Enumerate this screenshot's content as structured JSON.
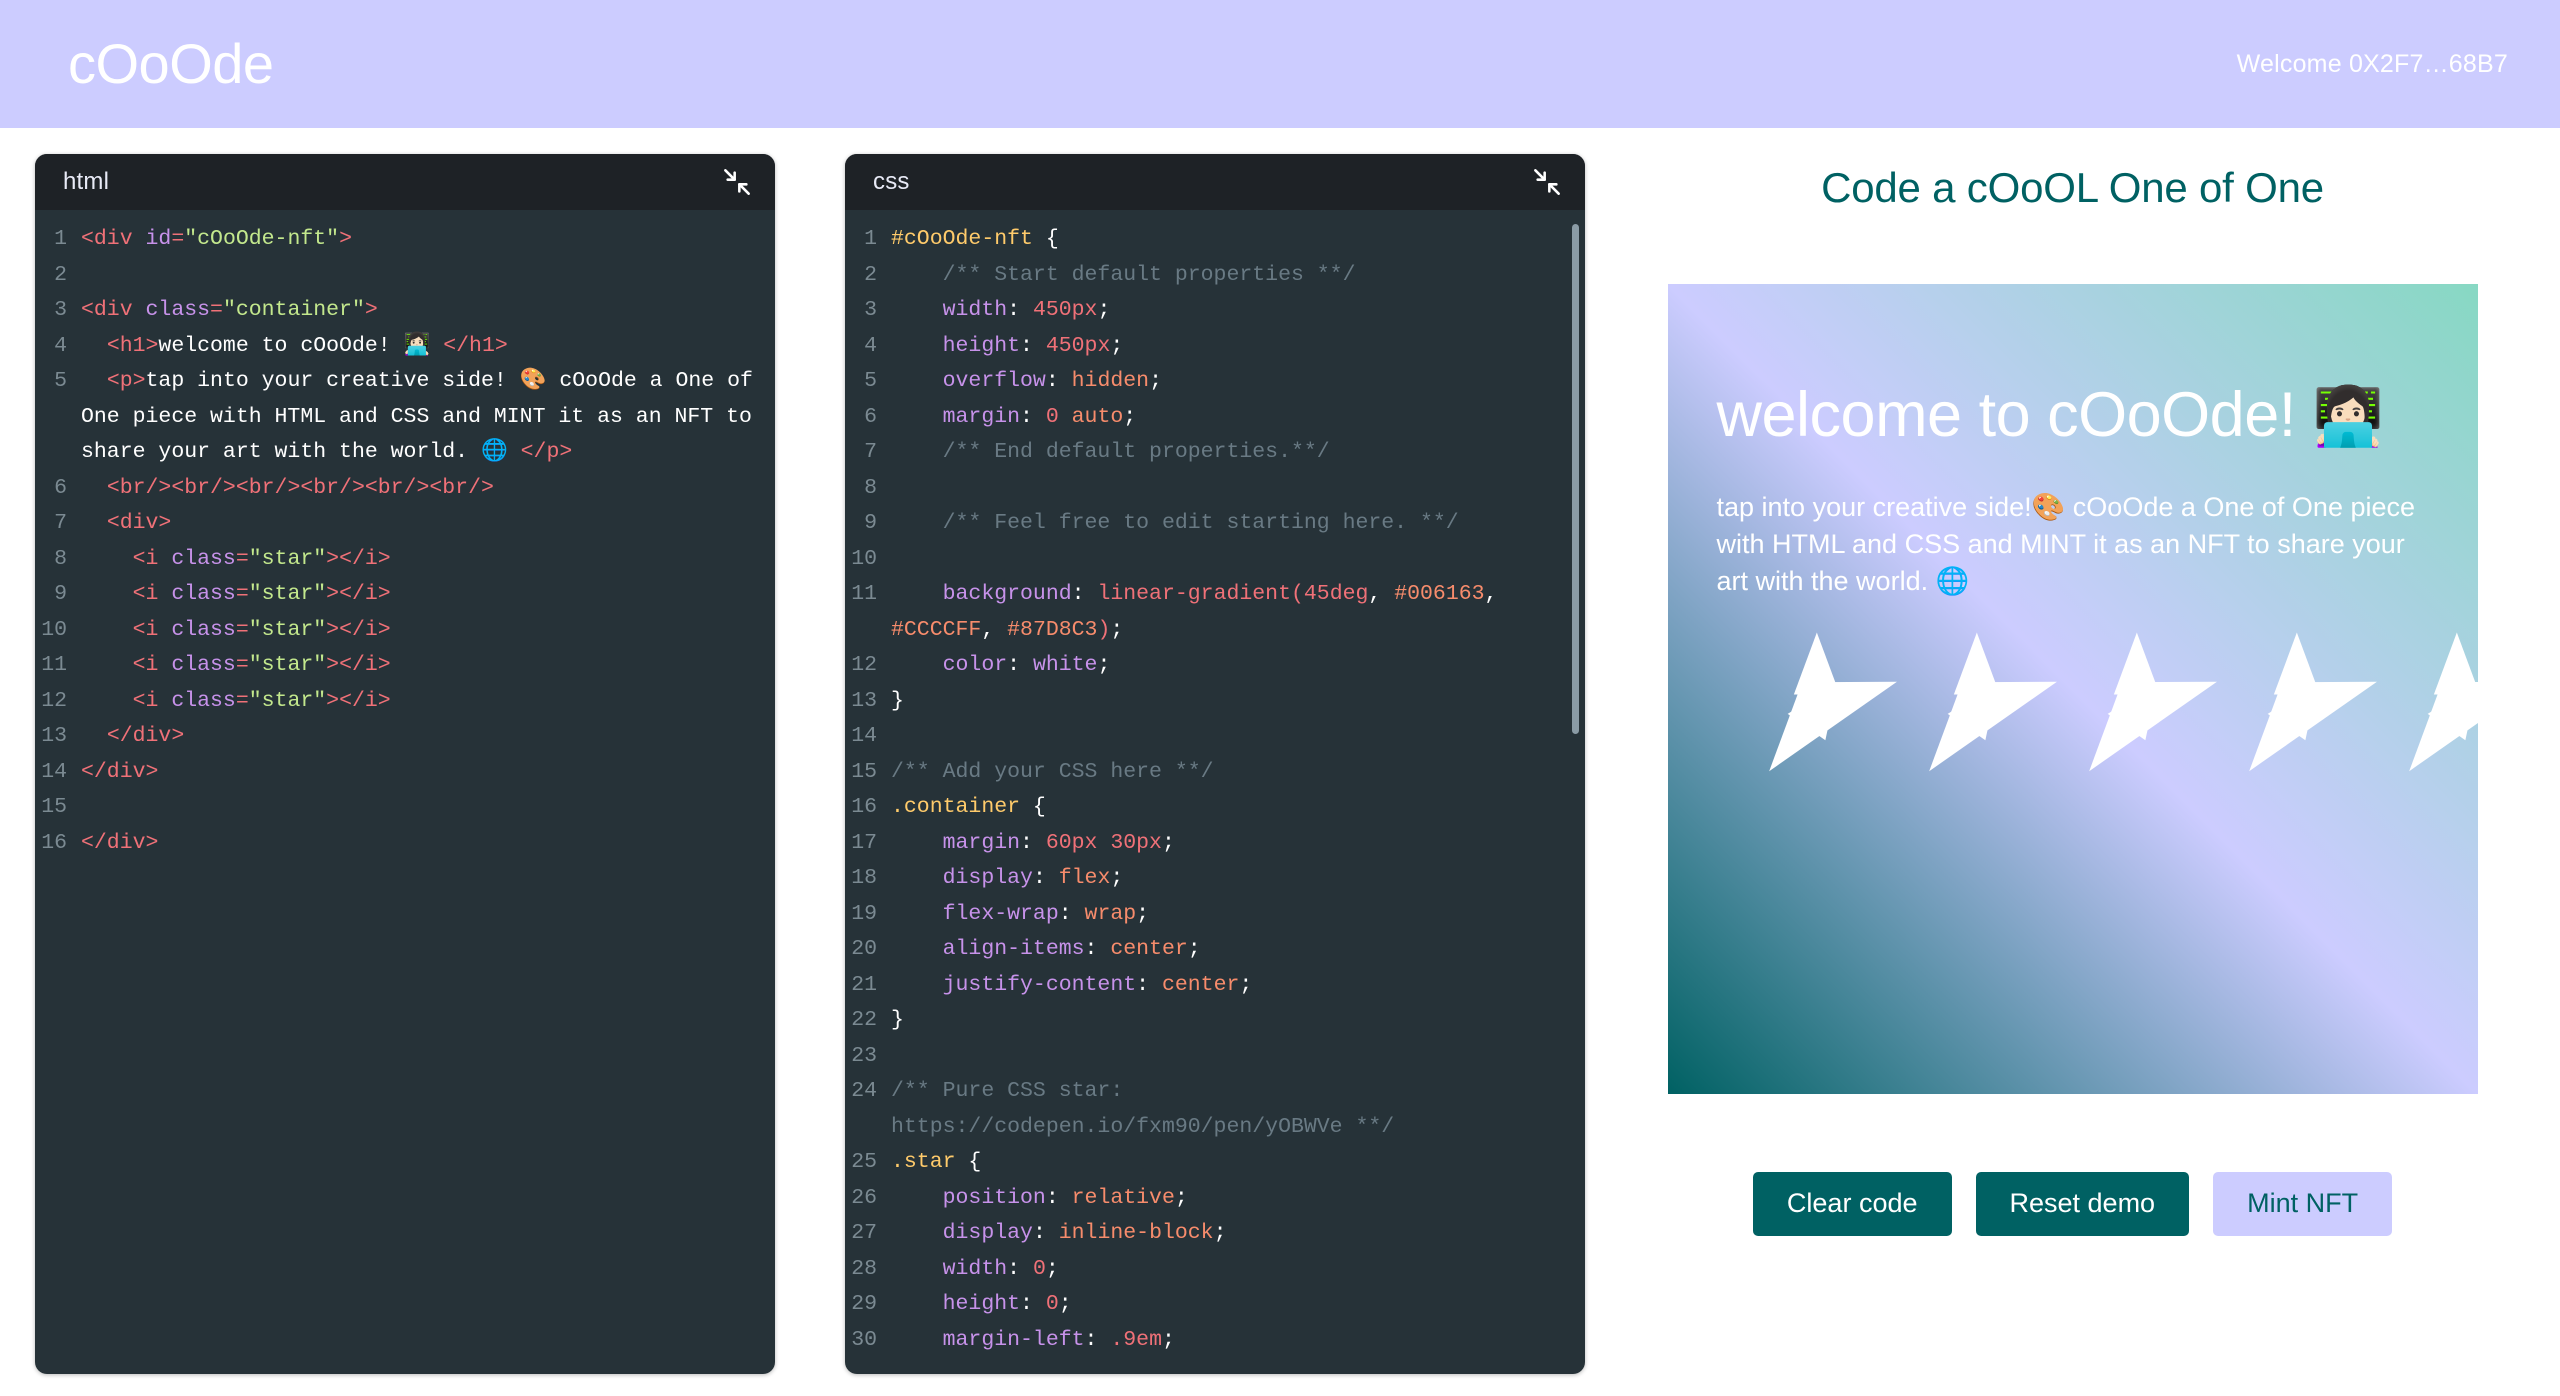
{
  "header": {
    "brand": "cOoOde",
    "wallet_welcome": "Welcome 0X2F7…68B7",
    "background_color": "#CCCCFF",
    "text_color": "#FFFFFF"
  },
  "editors": [
    {
      "title": "html",
      "collapse_icon": "collapse-arrows-icon",
      "lines": [
        {
          "n": "1",
          "tokens": [
            {
              "c": "t-tag",
              "t": "<div "
            },
            {
              "c": "t-attr",
              "t": "id"
            },
            {
              "c": "t-tag",
              "t": "="
            },
            {
              "c": "t-str",
              "t": "\"cOoOde-nft\""
            },
            {
              "c": "t-tag",
              "t": ">"
            }
          ]
        },
        {
          "n": "2",
          "tokens": []
        },
        {
          "n": "3",
          "tokens": [
            {
              "c": "t-tag",
              "t": "<div "
            },
            {
              "c": "t-attr",
              "t": "class"
            },
            {
              "c": "t-tag",
              "t": "="
            },
            {
              "c": "t-str",
              "t": "\"container\""
            },
            {
              "c": "t-tag",
              "t": ">"
            }
          ]
        },
        {
          "n": "4",
          "tokens": [
            {
              "c": "t-txt",
              "t": "  "
            },
            {
              "c": "t-tag",
              "t": "<h1>"
            },
            {
              "c": "t-txt",
              "t": "welcome to cOoOde! 👩🏻‍💻 "
            },
            {
              "c": "t-tag",
              "t": "</h1>"
            }
          ]
        },
        {
          "n": "5",
          "tokens": [
            {
              "c": "t-txt",
              "t": "  "
            },
            {
              "c": "t-tag",
              "t": "<p>"
            },
            {
              "c": "t-txt",
              "t": "tap into your creative side! 🎨 cOoOde a One of One piece with HTML and CSS and MINT it as an NFT to share your art with the world. 🌐 "
            },
            {
              "c": "t-tag",
              "t": "</p>"
            }
          ]
        },
        {
          "n": "6",
          "tokens": [
            {
              "c": "t-txt",
              "t": "  "
            },
            {
              "c": "t-tag",
              "t": "<br/><br/><br/><br/><br/><br/>"
            }
          ]
        },
        {
          "n": "7",
          "tokens": [
            {
              "c": "t-txt",
              "t": "  "
            },
            {
              "c": "t-tag",
              "t": "<div>"
            }
          ]
        },
        {
          "n": "8",
          "tokens": [
            {
              "c": "t-txt",
              "t": "    "
            },
            {
              "c": "t-tag",
              "t": "<i "
            },
            {
              "c": "t-attr",
              "t": "class"
            },
            {
              "c": "t-tag",
              "t": "="
            },
            {
              "c": "t-str",
              "t": "\"star\""
            },
            {
              "c": "t-tag",
              "t": "></i>"
            }
          ]
        },
        {
          "n": "9",
          "tokens": [
            {
              "c": "t-txt",
              "t": "    "
            },
            {
              "c": "t-tag",
              "t": "<i "
            },
            {
              "c": "t-attr",
              "t": "class"
            },
            {
              "c": "t-tag",
              "t": "="
            },
            {
              "c": "t-str",
              "t": "\"star\""
            },
            {
              "c": "t-tag",
              "t": "></i>"
            }
          ]
        },
        {
          "n": "10",
          "tokens": [
            {
              "c": "t-txt",
              "t": "    "
            },
            {
              "c": "t-tag",
              "t": "<i "
            },
            {
              "c": "t-attr",
              "t": "class"
            },
            {
              "c": "t-tag",
              "t": "="
            },
            {
              "c": "t-str",
              "t": "\"star\""
            },
            {
              "c": "t-tag",
              "t": "></i>"
            }
          ]
        },
        {
          "n": "11",
          "tokens": [
            {
              "c": "t-txt",
              "t": "    "
            },
            {
              "c": "t-tag",
              "t": "<i "
            },
            {
              "c": "t-attr",
              "t": "class"
            },
            {
              "c": "t-tag",
              "t": "="
            },
            {
              "c": "t-str",
              "t": "\"star\""
            },
            {
              "c": "t-tag",
              "t": "></i>"
            }
          ]
        },
        {
          "n": "12",
          "tokens": [
            {
              "c": "t-txt",
              "t": "    "
            },
            {
              "c": "t-tag",
              "t": "<i "
            },
            {
              "c": "t-attr",
              "t": "class"
            },
            {
              "c": "t-tag",
              "t": "="
            },
            {
              "c": "t-str",
              "t": "\"star\""
            },
            {
              "c": "t-tag",
              "t": "></i>"
            }
          ]
        },
        {
          "n": "13",
          "tokens": [
            {
              "c": "t-txt",
              "t": "  "
            },
            {
              "c": "t-tag",
              "t": "</div>"
            }
          ]
        },
        {
          "n": "14",
          "tokens": [
            {
              "c": "t-tag",
              "t": "</div>"
            }
          ]
        },
        {
          "n": "15",
          "tokens": []
        },
        {
          "n": "16",
          "tokens": [
            {
              "c": "t-tag",
              "t": "</div>"
            }
          ]
        }
      ]
    },
    {
      "title": "css",
      "collapse_icon": "collapse-arrows-icon",
      "lines": [
        {
          "n": "1",
          "tokens": [
            {
              "c": "t-sel",
              "t": "#cOoOde-nft"
            },
            {
              "c": "t-punc",
              "t": " {"
            }
          ]
        },
        {
          "n": "2",
          "tokens": [
            {
              "c": "t-comment",
              "t": "    /** Start default properties **/"
            }
          ]
        },
        {
          "n": "3",
          "tokens": [
            {
              "c": "t-prop",
              "t": "    width"
            },
            {
              "c": "t-punc",
              "t": ": "
            },
            {
              "c": "t-num",
              "t": "450px"
            },
            {
              "c": "t-punc",
              "t": ";"
            }
          ]
        },
        {
          "n": "4",
          "tokens": [
            {
              "c": "t-prop",
              "t": "    height"
            },
            {
              "c": "t-punc",
              "t": ": "
            },
            {
              "c": "t-num",
              "t": "450px"
            },
            {
              "c": "t-punc",
              "t": ";"
            }
          ]
        },
        {
          "n": "5",
          "tokens": [
            {
              "c": "t-prop",
              "t": "    overflow"
            },
            {
              "c": "t-punc",
              "t": ": "
            },
            {
              "c": "t-val",
              "t": "hidden"
            },
            {
              "c": "t-punc",
              "t": ";"
            }
          ]
        },
        {
          "n": "6",
          "tokens": [
            {
              "c": "t-prop",
              "t": "    margin"
            },
            {
              "c": "t-punc",
              "t": ": "
            },
            {
              "c": "t-num",
              "t": "0"
            },
            {
              "c": "t-punc",
              "t": " "
            },
            {
              "c": "t-val",
              "t": "auto"
            },
            {
              "c": "t-punc",
              "t": ";"
            }
          ]
        },
        {
          "n": "7",
          "tokens": [
            {
              "c": "t-comment",
              "t": "    /** End default properties.**/"
            }
          ]
        },
        {
          "n": "8",
          "tokens": []
        },
        {
          "n": "9",
          "tokens": [
            {
              "c": "t-comment",
              "t": "    /** Feel free to edit starting here. **/"
            }
          ]
        },
        {
          "n": "10",
          "tokens": []
        },
        {
          "n": "11",
          "tokens": [
            {
              "c": "t-prop",
              "t": "    background"
            },
            {
              "c": "t-punc",
              "t": ": "
            },
            {
              "c": "t-func",
              "t": "linear-gradient("
            },
            {
              "c": "t-num",
              "t": "45deg"
            },
            {
              "c": "t-punc",
              "t": ", "
            },
            {
              "c": "t-val",
              "t": "#006163"
            },
            {
              "c": "t-punc",
              "t": ", "
            },
            {
              "c": "t-val",
              "t": "#CCCCFF"
            },
            {
              "c": "t-punc",
              "t": ", "
            },
            {
              "c": "t-val",
              "t": "#87D8C3"
            },
            {
              "c": "t-func",
              "t": ")"
            },
            {
              "c": "t-punc",
              "t": ";"
            }
          ]
        },
        {
          "n": "12",
          "tokens": [
            {
              "c": "t-prop",
              "t": "    color"
            },
            {
              "c": "t-punc",
              "t": ": "
            },
            {
              "c": "t-prop",
              "t": "white"
            },
            {
              "c": "t-punc",
              "t": ";"
            }
          ]
        },
        {
          "n": "13",
          "tokens": [
            {
              "c": "t-punc",
              "t": "}"
            }
          ]
        },
        {
          "n": "14",
          "tokens": []
        },
        {
          "n": "15",
          "tokens": [
            {
              "c": "t-comment",
              "t": "/** Add your CSS here **/"
            }
          ]
        },
        {
          "n": "16",
          "tokens": [
            {
              "c": "t-sel",
              "t": ".container"
            },
            {
              "c": "t-punc",
              "t": " {"
            }
          ]
        },
        {
          "n": "17",
          "tokens": [
            {
              "c": "t-prop",
              "t": "    margin"
            },
            {
              "c": "t-punc",
              "t": ": "
            },
            {
              "c": "t-num",
              "t": "60px 30px"
            },
            {
              "c": "t-punc",
              "t": ";"
            }
          ]
        },
        {
          "n": "18",
          "tokens": [
            {
              "c": "t-prop",
              "t": "    display"
            },
            {
              "c": "t-punc",
              "t": ": "
            },
            {
              "c": "t-val",
              "t": "flex"
            },
            {
              "c": "t-punc",
              "t": ";"
            }
          ]
        },
        {
          "n": "19",
          "tokens": [
            {
              "c": "t-prop",
              "t": "    flex-wrap"
            },
            {
              "c": "t-punc",
              "t": ": "
            },
            {
              "c": "t-val",
              "t": "wrap"
            },
            {
              "c": "t-punc",
              "t": ";"
            }
          ]
        },
        {
          "n": "20",
          "tokens": [
            {
              "c": "t-prop",
              "t": "    align-items"
            },
            {
              "c": "t-punc",
              "t": ": "
            },
            {
              "c": "t-val",
              "t": "center"
            },
            {
              "c": "t-punc",
              "t": ";"
            }
          ]
        },
        {
          "n": "21",
          "tokens": [
            {
              "c": "t-prop",
              "t": "    justify-content"
            },
            {
              "c": "t-punc",
              "t": ": "
            },
            {
              "c": "t-val",
              "t": "center"
            },
            {
              "c": "t-punc",
              "t": ";"
            }
          ]
        },
        {
          "n": "22",
          "tokens": [
            {
              "c": "t-punc",
              "t": "}"
            }
          ]
        },
        {
          "n": "23",
          "tokens": []
        },
        {
          "n": "24",
          "tokens": [
            {
              "c": "t-comment",
              "t": "/** Pure CSS star: https://codepen.io/fxm90/pen/yOBWVe **/"
            }
          ]
        },
        {
          "n": "25",
          "tokens": [
            {
              "c": "t-sel",
              "t": ".star"
            },
            {
              "c": "t-punc",
              "t": " {"
            }
          ]
        },
        {
          "n": "26",
          "tokens": [
            {
              "c": "t-prop",
              "t": "    position"
            },
            {
              "c": "t-punc",
              "t": ": "
            },
            {
              "c": "t-val",
              "t": "relative"
            },
            {
              "c": "t-punc",
              "t": ";"
            }
          ]
        },
        {
          "n": "27",
          "tokens": [
            {
              "c": "t-prop",
              "t": "    display"
            },
            {
              "c": "t-punc",
              "t": ": "
            },
            {
              "c": "t-val",
              "t": "inline-block"
            },
            {
              "c": "t-punc",
              "t": ";"
            }
          ]
        },
        {
          "n": "28",
          "tokens": [
            {
              "c": "t-prop",
              "t": "    width"
            },
            {
              "c": "t-punc",
              "t": ": "
            },
            {
              "c": "t-num",
              "t": "0"
            },
            {
              "c": "t-punc",
              "t": ";"
            }
          ]
        },
        {
          "n": "29",
          "tokens": [
            {
              "c": "t-prop",
              "t": "    height"
            },
            {
              "c": "t-punc",
              "t": ": "
            },
            {
              "c": "t-num",
              "t": "0"
            },
            {
              "c": "t-punc",
              "t": ";"
            }
          ]
        },
        {
          "n": "30",
          "tokens": [
            {
              "c": "t-prop",
              "t": "    margin-left"
            },
            {
              "c": "t-punc",
              "t": ": "
            },
            {
              "c": "t-num",
              "t": ".9em"
            },
            {
              "c": "t-punc",
              "t": ";"
            }
          ]
        }
      ]
    }
  ],
  "preview": {
    "title": "Code a cOoOL One of One",
    "title_color": "#006163",
    "nft": {
      "gradient": "linear-gradient(45deg, #006163, #CCCCFF, #87D8C3)",
      "heading": "welcome to cOoOde!",
      "heading_emoji": "👩🏻‍💻",
      "paragraph_part1": "tap into your creative side!",
      "paragraph_emoji1": "🎨",
      "paragraph_part2": " cOoOde a One of One piece with HTML and CSS and MINT it as an NFT to share your art with the world.",
      "paragraph_emoji2": "🌐",
      "star_count": 5
    }
  },
  "actions": {
    "clear_code": "Clear code",
    "reset_demo": "Reset demo",
    "mint_nft": "Mint NFT",
    "primary_color": "#006163",
    "accent_color": "#CCCCFF"
  }
}
